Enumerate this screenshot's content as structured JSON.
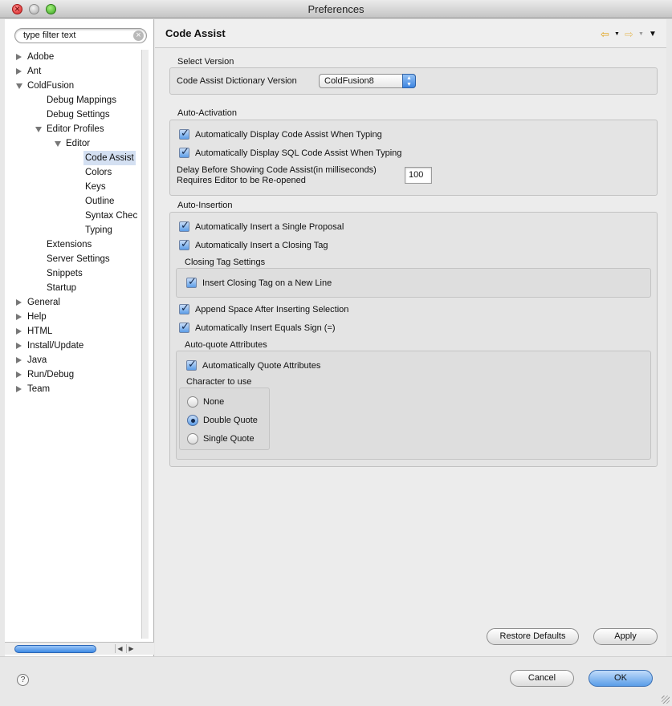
{
  "window": {
    "title": "Preferences"
  },
  "sidebar": {
    "filter_placeholder": "type filter text",
    "items": [
      {
        "label": "Adobe",
        "level": 0,
        "expander": "collapsed"
      },
      {
        "label": "Ant",
        "level": 0,
        "expander": "collapsed"
      },
      {
        "label": "ColdFusion",
        "level": 0,
        "expander": "expanded"
      },
      {
        "label": "Debug Mappings",
        "level": 1,
        "expander": "none"
      },
      {
        "label": "Debug Settings",
        "level": 1,
        "expander": "none"
      },
      {
        "label": "Editor Profiles",
        "level": 1,
        "expander": "expanded"
      },
      {
        "label": "Editor",
        "level": 2,
        "expander": "expanded"
      },
      {
        "label": "Code Assist",
        "level": 3,
        "expander": "none",
        "selected": true
      },
      {
        "label": "Colors",
        "level": 3,
        "expander": "none"
      },
      {
        "label": "Keys",
        "level": 3,
        "expander": "none"
      },
      {
        "label": "Outline",
        "level": 3,
        "expander": "none"
      },
      {
        "label": "Syntax Chec",
        "level": 3,
        "expander": "none"
      },
      {
        "label": "Typing",
        "level": 3,
        "expander": "none"
      },
      {
        "label": "Extensions",
        "level": 1,
        "expander": "none"
      },
      {
        "label": "Server Settings",
        "level": 1,
        "expander": "none"
      },
      {
        "label": "Snippets",
        "level": 1,
        "expander": "none"
      },
      {
        "label": "Startup",
        "level": 1,
        "expander": "none"
      },
      {
        "label": "General",
        "level": 0,
        "expander": "collapsed"
      },
      {
        "label": "Help",
        "level": 0,
        "expander": "collapsed"
      },
      {
        "label": "HTML",
        "level": 0,
        "expander": "collapsed"
      },
      {
        "label": "Install/Update",
        "level": 0,
        "expander": "collapsed"
      },
      {
        "label": "Java",
        "level": 0,
        "expander": "collapsed"
      },
      {
        "label": "Run/Debug",
        "level": 0,
        "expander": "collapsed"
      },
      {
        "label": "Team",
        "level": 0,
        "expander": "collapsed"
      }
    ]
  },
  "main": {
    "title": "Code Assist",
    "nav": {
      "back_icon": "arrow-left-icon",
      "forward_icon": "arrow-right-icon",
      "menu_icon": "chevron-down-icon"
    },
    "select_version": {
      "group_label": "Select Version",
      "dictionary_label": "Code Assist Dictionary Version",
      "dictionary_value": "ColdFusion8"
    },
    "auto_activation": {
      "group_label": "Auto-Activation",
      "display_code_assist": "Automatically Display Code Assist When Typing",
      "display_sql_assist": "Automatically Display SQL Code Assist When Typing",
      "delay_label_line1": "Delay Before Showing Code Assist(in milliseconds)",
      "delay_label_line2": "Requires Editor to be Re-opened",
      "delay_value": "100"
    },
    "auto_insertion": {
      "group_label": "Auto-Insertion",
      "single_proposal": "Automatically Insert a Single Proposal",
      "closing_tag": "Automatically Insert a Closing Tag",
      "closing_tag_settings_label": "Closing Tag Settings",
      "closing_tag_new_line": "Insert Closing Tag on a New Line",
      "append_space": "Append Space After Inserting Selection",
      "equals_sign": "Automatically Insert Equals Sign (=)",
      "auto_quote_label": "Auto-quote Attributes",
      "auto_quote_checkbox": "Automatically Quote Attributes",
      "character_label": "Character to use",
      "options": [
        "None",
        "Double Quote",
        "Single Quote"
      ],
      "selected_option": "Double Quote"
    },
    "restore_defaults": "Restore Defaults",
    "apply": "Apply"
  },
  "footer": {
    "cancel": "Cancel",
    "ok": "OK",
    "help_icon": "question-mark-icon"
  },
  "colors": {
    "accent": "#5a9de8",
    "selection": "#d4e0f2"
  }
}
